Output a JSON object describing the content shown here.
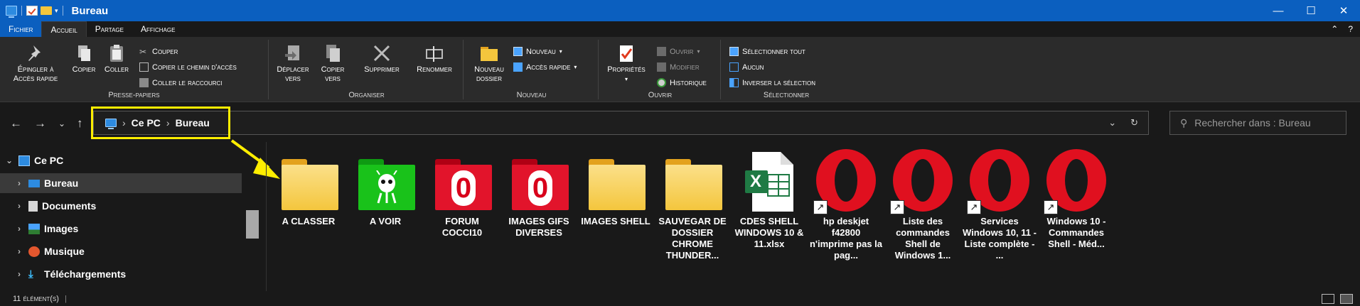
{
  "titlebar": {
    "title": "Bureau",
    "controls": {
      "minimize": "—",
      "maximize": "☐",
      "close": "✕"
    },
    "accent": "#0b5fbf"
  },
  "tabs": [
    {
      "label": "Fichier"
    },
    {
      "label": "Accueil"
    },
    {
      "label": "Partage"
    },
    {
      "label": "Affichage"
    }
  ],
  "ribbon": {
    "clipboard": {
      "label": "Presse-papiers",
      "pin": "Épingler à\nAccès rapide",
      "copy": "Copier",
      "paste": "Coller",
      "cut": "Couper",
      "copy_path": "Copier le chemin d'accès",
      "paste_shortcut": "Coller le raccourci"
    },
    "organize": {
      "label": "Organiser",
      "move": "Déplacer\nvers",
      "copyto": "Copier\nvers",
      "delete": "Supprimer",
      "rename": "Renommer"
    },
    "new": {
      "label": "Nouveau",
      "new_folder": "Nouveau\ndossier",
      "new_item": "Nouveau",
      "easy_access": "Accès rapide"
    },
    "open": {
      "label": "Ouvrir",
      "properties": "Propriétés",
      "open": "Ouvrir",
      "edit": "Modifier",
      "history": "Historique"
    },
    "select": {
      "label": "Sélectionner",
      "select_all": "Sélectionner tout",
      "select_none": "Aucun",
      "invert": "Inverser la sélection"
    }
  },
  "address": {
    "crumbs": [
      "Ce PC",
      "Bureau"
    ],
    "sep": "›",
    "search_placeholder": "Rechercher dans : Bureau"
  },
  "nav": {
    "items": [
      {
        "label": "Ce PC"
      },
      {
        "label": "Bureau"
      },
      {
        "label": "Documents"
      },
      {
        "label": "Images"
      },
      {
        "label": "Musique"
      },
      {
        "label": "Téléchargements"
      }
    ]
  },
  "items": [
    {
      "name": "A CLASSER",
      "kind": "folder"
    },
    {
      "name": "A VOIR",
      "kind": "folder-green"
    },
    {
      "name": "FORUM COCCI10",
      "kind": "folder-red"
    },
    {
      "name": "IMAGES GIFS DIVERSES",
      "kind": "folder-red"
    },
    {
      "name": "IMAGES SHELL",
      "kind": "folder"
    },
    {
      "name": "SAUVEGAR DE DOSSIER CHROME THUNDER...",
      "kind": "folder"
    },
    {
      "name": "CDES SHELL WINDOWS 10 & 11.xlsx",
      "kind": "excel"
    },
    {
      "name": "hp deskjet f42800 n'imprime pas la pag...",
      "kind": "opera"
    },
    {
      "name": "Liste des commandes Shell de Windows 1...",
      "kind": "opera"
    },
    {
      "name": "Services Windows 10, 11 - Liste complète - ...",
      "kind": "opera"
    },
    {
      "name": "Windows 10 - Commandes Shell - Méd...",
      "kind": "opera"
    }
  ],
  "folder_digit": "0",
  "excel_letter": "X",
  "status": {
    "count": "11 élément(s)"
  },
  "colors": {
    "highlight": "#ffee00",
    "folder": "#f4c63d",
    "green_folder": "#19c21a",
    "red_folder": "#d8001b",
    "opera": "#e0101f",
    "excel": "#1f7a44"
  }
}
